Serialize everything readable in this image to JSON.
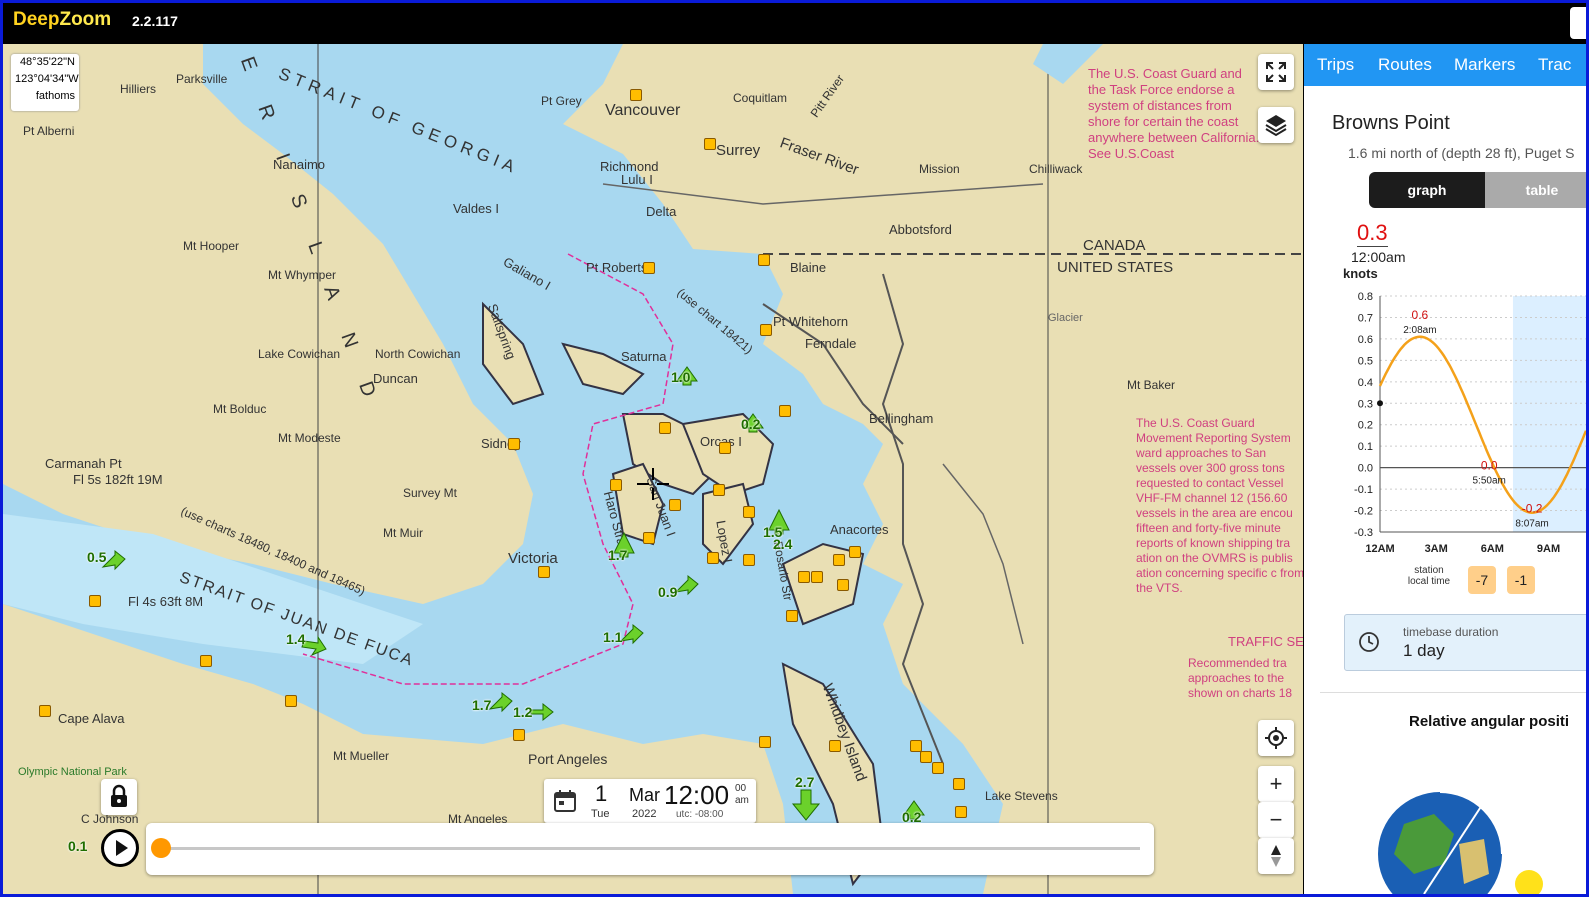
{
  "app": {
    "brand_a": "Deep",
    "brand_b": "Zoom",
    "version": "2.2.117"
  },
  "map": {
    "coords": {
      "lat": "48°35'22\"N",
      "lon": "123°04'34\"W",
      "depth_unit": "fathoms"
    },
    "labels": {
      "strait_georgia": "STRAIT OF GEORGIA",
      "strait_juan": "STRAIT OF JUAN DE FUCA",
      "vancouver": "Vancouver",
      "surrey": "Surrey",
      "richmond": "Richmond",
      "lulu": "Lulu I",
      "delta": "Delta",
      "nanaimo": "Nanaimo",
      "valdes": "Valdes I",
      "galiano": "Galiano I",
      "saltspring": "Saltspring",
      "saturna": "Saturna",
      "duncan": "Duncan",
      "pt_roberts": "Pt Roberts",
      "blaine": "Blaine",
      "pt_whitehorn": "Pt Whitehorn",
      "ferndale": "Ferndale",
      "bellingham": "Bellingham",
      "orcas": "Orcas I",
      "lopez": "Lopez I",
      "san_juan": "San Juan I",
      "anacortes": "Anacortes",
      "victoria": "Victoria",
      "port_angeles": "Port Angeles",
      "cape_alava": "Cape Alava",
      "whidbey": "Whidbey Island",
      "canada": "CANADA",
      "usa": "UNITED STATES",
      "abbotsford": "Abbotsford",
      "mission": "Mission",
      "chilliwack": "Chilliwack",
      "mt_baker": "Mt Baker",
      "fraser": "Fraser River",
      "lake_cowichan": "Lake Cowichan",
      "north_cowichan": "North Cowichan",
      "carmanah": "Carmanah Pt",
      "light1": "Fl 5s 182ft 19M",
      "light2": "Fl 4s 63ft 8M",
      "sidney": "Sidney",
      "haro": "Haro Strait",
      "rosario": "Rosario Str",
      "use_chart1": "(use chart 18421)",
      "use_charts": "(use charts 18480, 18400 and 18465)",
      "uscg1": "The U.S. Coast Guard and the Task Force endorse a system of distances from shore for certain the coast anywhere between California. See U.S.Coast",
      "uscg2": "The U.S. Coast Guard Movement Reporting System ward approaches to San vessels over 300 gross tons requested to contact Vessel VHF-FM channel 12 (156.60 vessels in the area are encou fifteen and forty-five minute reports of known shipping tra ation on the OVMRS is publis ation concerning specific c from the VTS.",
      "traffic": "TRAFFIC SE",
      "recommended": "Recommended tra approaches to the shown on charts 18",
      "lake_stevens": "Lake Stevens",
      "pt_grey": "Pt Grey",
      "coquitlam": "Coquitlam",
      "pitt": "Pitt River",
      "mt_bolduc": "Mt Bolduc",
      "mt_modeste": "Mt Modeste",
      "survey_mt": "Survey Mt",
      "mt_muir": "Mt Muir",
      "mt_mueller": "Mt Mueller",
      "mt_angeles": "Mt Angeles",
      "c_johnson": "C Johnson",
      "parksville": "Parksville",
      "hilliers": "Hilliers",
      "pt_alberni": "Pt Alberni",
      "mt_hooper": "Mt Hooper",
      "mt_whymper": "Mt Whymper",
      "glacier": "Glacier",
      "olympic": "Olympic National Park",
      "island_letters": "V E R  I S L A N D"
    },
    "currents": [
      {
        "id": "c1",
        "value": "1.0"
      },
      {
        "id": "c2",
        "value": "0.2"
      },
      {
        "id": "c3",
        "value": "1.7"
      },
      {
        "id": "c4",
        "value": "1.5"
      },
      {
        "id": "c5",
        "value": "2.4"
      },
      {
        "id": "c6",
        "value": "0.9"
      },
      {
        "id": "c7",
        "value": "0.5"
      },
      {
        "id": "c8",
        "value": "1.4"
      },
      {
        "id": "c9",
        "value": "1.1"
      },
      {
        "id": "c10",
        "value": "1.7"
      },
      {
        "id": "c11",
        "value": "1.2"
      },
      {
        "id": "c12",
        "value": "2.7"
      },
      {
        "id": "c13",
        "value": "0.2"
      },
      {
        "id": "c14",
        "value": "0.1"
      }
    ]
  },
  "datetime": {
    "day": "1",
    "weekday": "Tue",
    "month": "Mar",
    "year": "2022",
    "time": "12:00",
    "seconds": "00",
    "ampm": "am",
    "utc": "utc: -08:00"
  },
  "panel": {
    "tabs": [
      "Trips",
      "Routes",
      "Markers",
      "Trac"
    ],
    "station": "Browns Point",
    "subtitle": "1.6 mi north of (depth 28 ft), Puget S",
    "toggle": {
      "graph": "graph",
      "table": "table"
    },
    "current_value": "0.3",
    "current_time": "12:00am",
    "units": "knots",
    "tz_label": "station local time",
    "tz_buttons": [
      "-7",
      "-1"
    ],
    "timebase_label": "timebase duration",
    "timebase_value": "1 day",
    "relative_title": "Relative angular positi"
  },
  "chart_data": {
    "type": "line",
    "title": "",
    "ylabel": "knots",
    "ylim": [
      -0.3,
      0.8
    ],
    "yticks": [
      "0.8",
      "0.7",
      "0.6",
      "0.5",
      "0.4",
      "0.3",
      "0.2",
      "0.1",
      "0.0",
      "-0.1",
      "-0.2",
      "-0.3"
    ],
    "xticks": [
      "12AM",
      "3AM",
      "6AM",
      "9AM"
    ],
    "series": [
      {
        "x": [
          0,
          2.13,
          5.83,
          8.12
        ],
        "values": [
          0.3,
          0.6,
          0.0,
          -0.2
        ]
      }
    ],
    "annotations": [
      {
        "value": "0.6",
        "time": "2:08am"
      },
      {
        "value": "0.0",
        "time": "5:50am"
      },
      {
        "value": "-0.2",
        "time": "8:07am"
      }
    ],
    "colors": {
      "line": "#f4a11a",
      "night": "#dcefff"
    }
  }
}
